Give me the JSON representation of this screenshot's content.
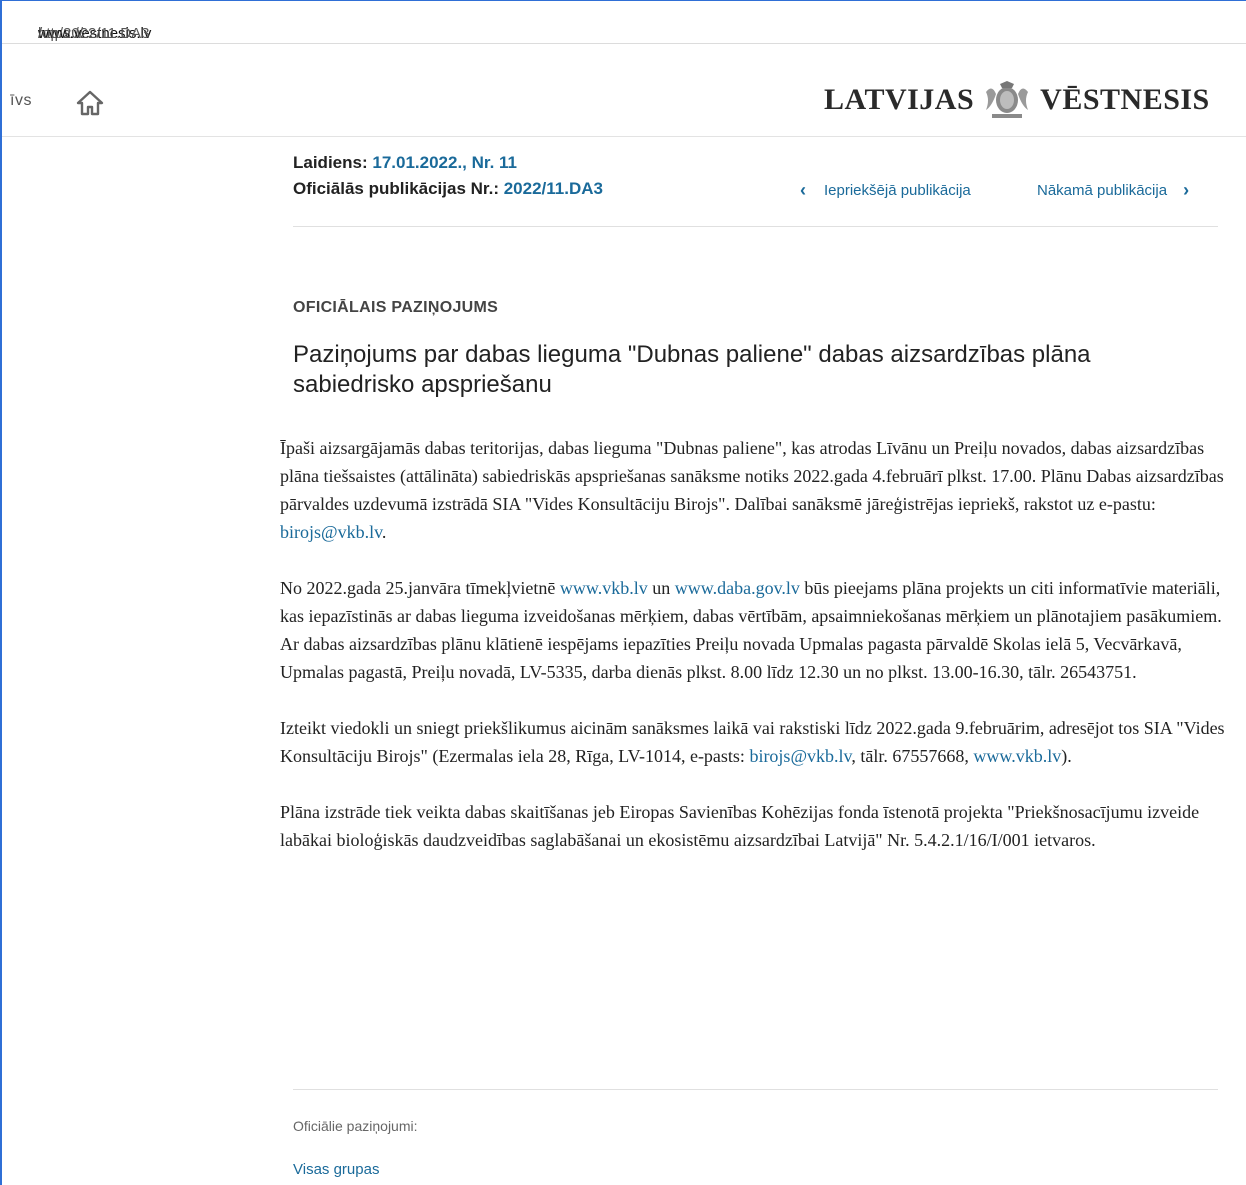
{
  "browser": {
    "url_proto": "https://",
    "url_host": "www.vestnesis.lv",
    "url_path": "/op/2022/11.DA3"
  },
  "nav": {
    "fragment": "īvs",
    "home_icon": "home-icon"
  },
  "logo": {
    "left": "LATVIJAS",
    "right": "VĒSTNESIS"
  },
  "meta": {
    "issue_label": "Laidiens:",
    "issue_value": "17.01.2022., Nr. 11",
    "pub_label": "Oficiālās publikācijas Nr.:",
    "pub_value": "2022/11.DA3"
  },
  "pubnav": {
    "prev": "Iepriekšējā publikācija",
    "next": "Nākamā publikācija"
  },
  "article": {
    "category": "OFICIĀLAIS PAZIŅOJUMS",
    "title": "Paziņojums par dabas lieguma \"Dubnas paliene\" dabas aizsardzības plāna sabiedrisko apspriešanu",
    "p1_text": "Īpaši aizsargājamās dabas teritorijas, dabas lieguma \"Dubnas paliene\", kas atrodas Līvānu un Preiļu novados, dabas aizsardzības plāna tiešsaistes (attālināta) sabiedriskās apspriešanas sanāksme notiks 2022.gada 4.februārī plkst. 17.00. Plānu Dabas aizsardzības pārvaldes uzdevumā izstrādā SIA \"Vides Konsultāciju Birojs\". Dalībai sanāksmē jāreģistrējas iepriekš, rakstot uz e-pastu: ",
    "p1_link": "birojs@vkb.lv",
    "p1_end": ".",
    "p2_a": "No 2022.gada 25.janvāra tīmekļvietnē ",
    "p2_link1": "www.vkb.lv",
    "p2_b": " un ",
    "p2_link2": "www.daba.gov.lv",
    "p2_c": " būs pieejams plāna projekts un citi informatīvie materiāli, kas iepazīstinās ar dabas lieguma izveidošanas mērķiem, dabas vērtībām, apsaimniekošanas mērķiem un plānotajiem pasākumiem. Ar dabas aizsardzības plānu klātienē iespējams iepazīties Preiļu novada Upmalas pagasta pārvaldē Skolas ielā 5, Vecvārkavā, Upmalas pagastā, Preiļu novadā, LV-5335, darba dienās plkst. 8.00 līdz 12.30 un no plkst. 13.00-16.30, tālr. 26543751.",
    "p3_a": "Izteikt viedokli un sniegt priekšlikumus aicinām sanāksmes laikā vai rakstiski līdz 2022.gada 9.februārim, adresējot tos SIA \"Vides Konsultāciju Birojs\" (Ezermalas iela 28, Rīga, LV-1014, e-pasts: ",
    "p3_link1": "birojs@vkb.lv",
    "p3_b": ", tālr. 67557668, ",
    "p3_link2": "www.vkb.lv",
    "p3_c": ").",
    "p4": "Plāna izstrāde tiek veikta dabas skaitīšanas jeb Eiropas Savienības Kohēzijas fonda īstenotā projekta \"Priekšnosacījumu izveide labākai bioloģiskās daudzveidības saglabāšanai un ekosistēmu aizsardzībai Latvijā\" Nr. 5.4.2.1/16/I/001 ietvaros."
  },
  "footer": {
    "label": "Oficiālie paziņojumi:",
    "link": "Visas grupas"
  }
}
